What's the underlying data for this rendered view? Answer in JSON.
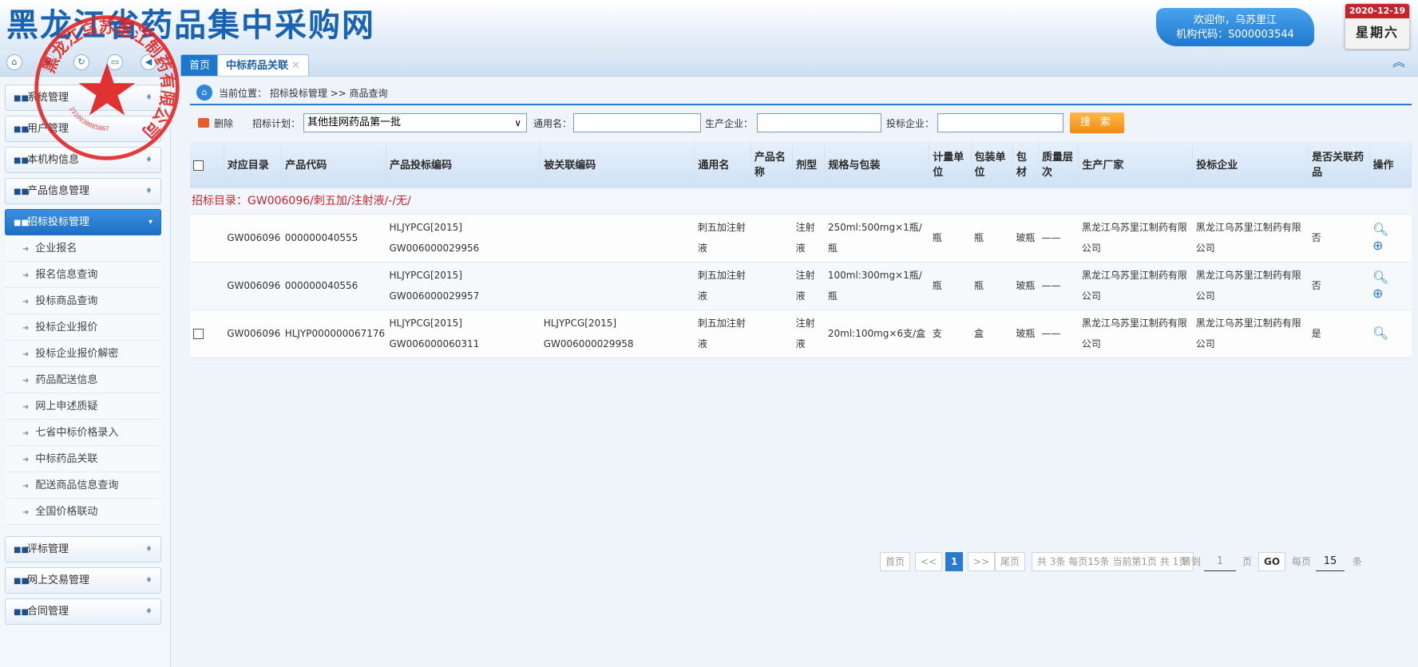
{
  "header": {
    "site_title": "黑龙江省药品集中采购网",
    "welcome": "欢迎你，乌苏里江",
    "org_code": "机构代码：S000003544",
    "date": "2020-12-19",
    "weekday": "星期六"
  },
  "tabs": {
    "home": "首页",
    "active": "中标药品关联",
    "close": "✕"
  },
  "stamp": {
    "text": "黑龙江乌苏里江制药有限公司",
    "number": "2310030085867"
  },
  "sidebar": {
    "groups_top": [
      {
        "label": "系统管理"
      },
      {
        "label": "用户管理"
      },
      {
        "label": "本机构信息"
      },
      {
        "label": "产品信息管理"
      },
      {
        "label": "招标投标管理"
      }
    ],
    "sub_items": [
      {
        "label": "企业报名"
      },
      {
        "label": "报名信息查询"
      },
      {
        "label": "投标商品查询"
      },
      {
        "label": "投标企业报价"
      },
      {
        "label": "投标企业报价解密"
      },
      {
        "label": "药品配送信息"
      },
      {
        "label": "网上申述质疑"
      },
      {
        "label": "七省中标价格录入"
      },
      {
        "label": "中标药品关联"
      },
      {
        "label": "配送商品信息查询"
      },
      {
        "label": "全国价格联动"
      }
    ],
    "groups_bottom": [
      {
        "label": "评标管理"
      },
      {
        "label": "网上交易管理"
      },
      {
        "label": "合同管理"
      }
    ]
  },
  "breadcrumb": {
    "text": "当前位置： 招标投标管理 >> 商品查询"
  },
  "toolbar": {
    "delete_label": "删除",
    "plan_label": "招标计划：",
    "plan_value": "其他挂网药品第一批",
    "generic_label": "通用名：",
    "manufacturer_label": "生产企业：",
    "bidder_label": "投标企业：",
    "search_label": "搜 索"
  },
  "table": {
    "headers": [
      "对应目录",
      "产品代码",
      "产品投标编码",
      "被关联编码",
      "通用名",
      "产品名称",
      "剂型",
      "规格与包装",
      "计量单位",
      "包装单位",
      "包材",
      "质量层次",
      "生产厂家",
      "投标企业",
      "是否关联药品",
      "操作"
    ],
    "group_title": "招标目录：GW006096/刺五加/注射液/-/无/",
    "rows": [
      {
        "catalog": "GW006096",
        "product_code": "000000040555",
        "bid_code_1": "HLJYPCG[2015]",
        "bid_code_2": "GW006000029956",
        "linked_code_1": "",
        "linked_code_2": "",
        "generic_name": "刺五加注射液",
        "product_name": "",
        "dosage_form": "注射液",
        "spec": "250ml:500mg×1瓶/瓶",
        "measure_unit": "瓶",
        "pack_unit": "瓶",
        "pack_material": "玻瓶",
        "quality": "——",
        "manufacturer": "黑龙江乌苏里江制药有限公司",
        "bidder": "黑龙江乌苏里江制药有限公司",
        "linked": "否"
      },
      {
        "catalog": "GW006096",
        "product_code": "000000040556",
        "bid_code_1": "HLJYPCG[2015]",
        "bid_code_2": "GW006000029957",
        "linked_code_1": "",
        "linked_code_2": "",
        "generic_name": "刺五加注射液",
        "product_name": "",
        "dosage_form": "注射液",
        "spec": "100ml:300mg×1瓶/瓶",
        "measure_unit": "瓶",
        "pack_unit": "瓶",
        "pack_material": "玻瓶",
        "quality": "——",
        "manufacturer": "黑龙江乌苏里江制药有限公司",
        "bidder": "黑龙江乌苏里江制药有限公司",
        "linked": "否"
      },
      {
        "catalog": "GW006096",
        "product_code": "HLJYP000000067176",
        "bid_code_1": "HLJYPCG[2015]",
        "bid_code_2": "GW006000060311",
        "linked_code_1": "HLJYPCG[2015]",
        "linked_code_2": "GW006000029958",
        "generic_name": "刺五加注射液",
        "product_name": "",
        "dosage_form": "注射液",
        "spec": "20ml:100mg×6支/盒",
        "measure_unit": "支",
        "pack_unit": "盒",
        "pack_material": "玻瓶",
        "quality": "——",
        "manufacturer": "黑龙江乌苏里江制药有限公司",
        "bidder": "黑龙江乌苏里江制药有限公司",
        "linked": "是"
      }
    ]
  },
  "pager": {
    "first": "首页",
    "prev": "<<",
    "current": "1",
    "next": ">>",
    "last": "尾页",
    "summary": "共 3条 每页15条 当前第1页 共 1页",
    "goto_label": "转到",
    "goto_value": "1",
    "page_unit": "页",
    "go": "GO",
    "per_page_label": "每页",
    "per_page_value": "15",
    "per_page_unit": "条"
  },
  "colors": {
    "brand_blue": "#1a63b3",
    "accent_blue": "#2a7bd0",
    "search_orange": "#f08c10",
    "stamp_red": "#e02020",
    "group_red": "#c0272d"
  },
  "icons": [
    "home-icon",
    "lock-icon",
    "refresh-icon",
    "window-icon",
    "sound-icon",
    "collapse-icon",
    "grid-icon",
    "delete-icon",
    "search-icon",
    "add-circle-icon",
    "checkbox-icon"
  ]
}
